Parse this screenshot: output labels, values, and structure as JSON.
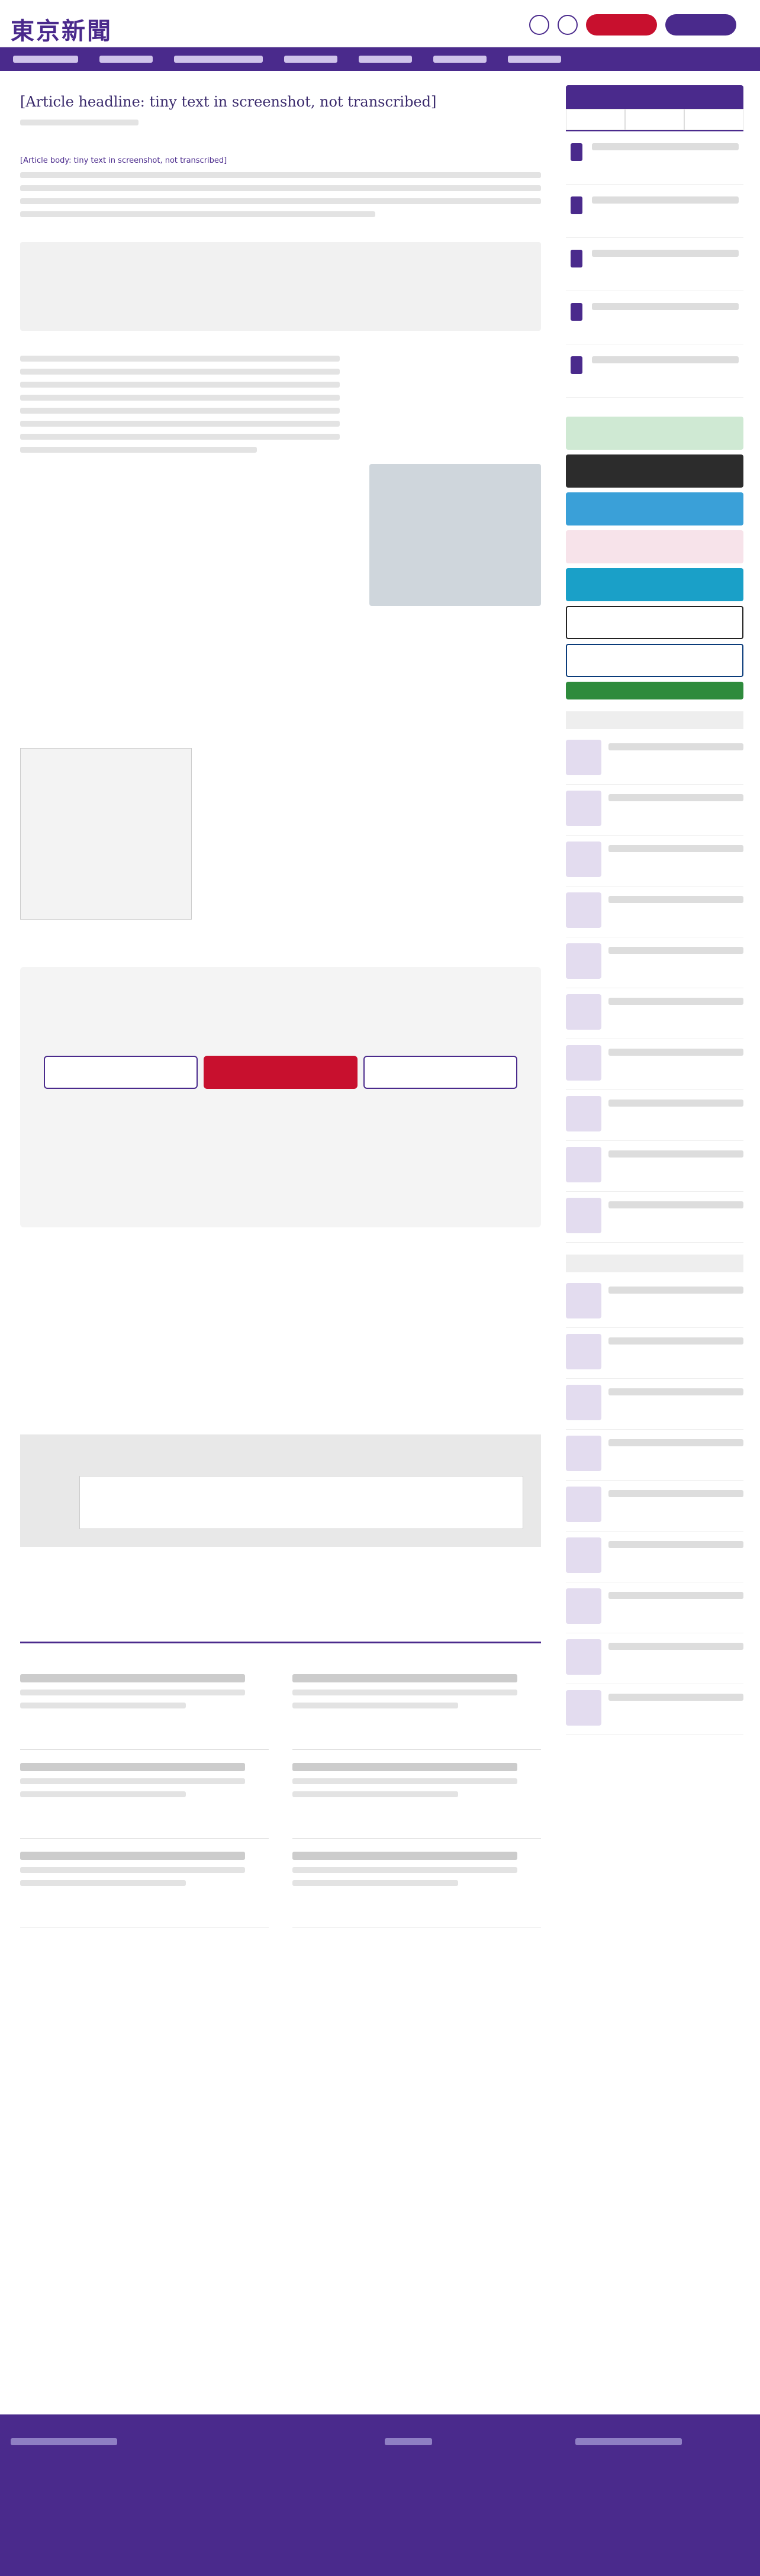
{
  "header": {
    "logo": "東京新聞"
  },
  "article": {
    "title": "[Article headline: tiny text in screenshot, not transcribed]",
    "body": "[Article body: tiny text in screenshot, not transcribed]"
  }
}
